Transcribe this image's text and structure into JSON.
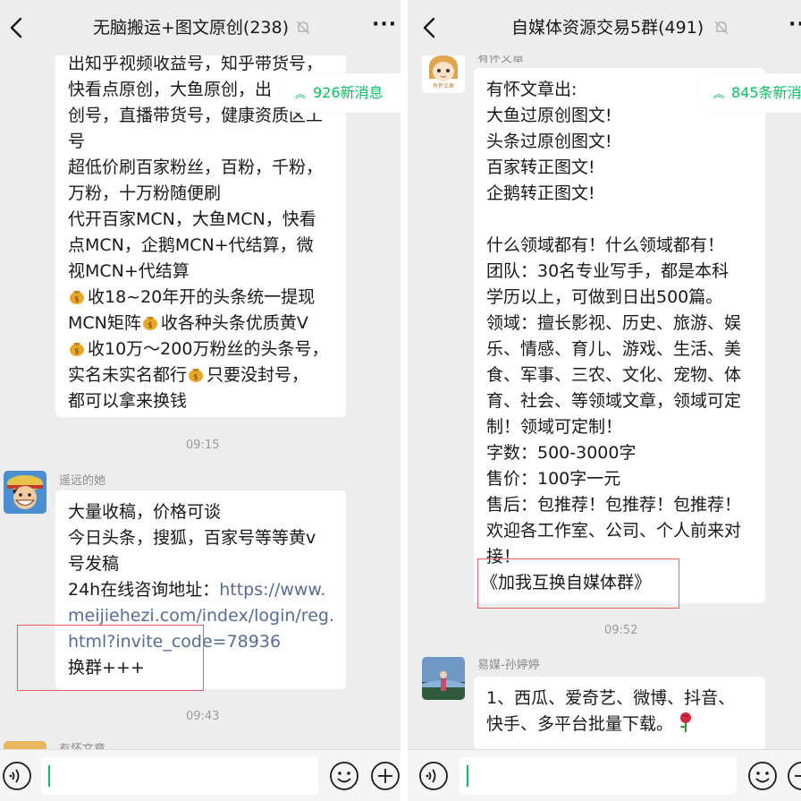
{
  "left_chat": {
    "title": "无脑搬运+图文原创(238)",
    "new_messages": "926新消息",
    "message_top": {
      "lines": [
        "出知乎视频收益号，知乎带货号，",
        "快看点原创，大鱼原创，出",
        "创号，直播带货号，健康资质区工",
        "号",
        "超低价刷百家粉丝，百粉，千粉，",
        "万粉，十万粉随便刷",
        "代开百家MCN，大鱼MCN，快看",
        "点MCN，企鹅MCN+代结算，微",
        "视MCN+代结算"
      ],
      "coin_lines": [
        [
          "收18~20年开的头条统一提现"
        ],
        [
          "MCN矩阵",
          "收各种头条优质黄V"
        ],
        [
          "收10万～200万粉丝的头条号，"
        ],
        [
          "实名未实名都行",
          "只要没封号，"
        ]
      ],
      "tail": "都可以拿来换钱"
    },
    "time1": "09:15",
    "sender2": "遥远的她",
    "message2": {
      "line1": "大量收稿，价格可谈",
      "line2": "今日头条，搜狐，百家号等等黄v",
      "line3": "号发稿",
      "line4_prefix": "24h在线咨询地址：",
      "line4_link": "https://www.",
      "line5_link": "meijiehezi.com/index/login/reg.",
      "line6_link": "html?invite_code=78936",
      "line7": "换群+++"
    },
    "time2": "09:43",
    "sender3_partial": "有怀文章"
  },
  "right_chat": {
    "title": "自媒体资源交易5群(491)",
    "new_messages": "845条新消",
    "sender1": "有怀文章",
    "avatar1_caption": "有怀文章",
    "message1": [
      "有怀文章出:",
      "大鱼过原创图文!",
      "头条过原创图文!",
      "百家转正图文!",
      "企鹅转正图文!",
      "",
      "什么领域都有！什么领域都有！",
      "团队：30名专业写手，都是本科",
      "学历以上，可做到日出500篇。",
      "领域：擅长影视、历史、旅游、娱",
      "乐、情感、育儿、游戏、生活、美",
      "食、军事、三农、文化、宠物、体",
      "育、社会、等领域文章，领域可定",
      "制！领域可定制！",
      "字数：500-3000字",
      "售价：100字一元",
      "售后：包推荐！包推荐！包推荐！",
      "欢迎各工作室、公司、个人前来对",
      "接！",
      "《加我互换自媒体群》"
    ],
    "time1": "09:52",
    "sender2": "易媒-孙婷婷",
    "message2": [
      "1、西瓜、爱奇艺、微博、抖音、",
      "快手、多平台批量下载。"
    ]
  },
  "colors": {
    "background": "#ededed",
    "bubble": "#ffffff",
    "link": "#576b95",
    "accent": "#07c160",
    "highlight_box": "#e86060"
  },
  "icons": [
    "back-icon",
    "mute-icon",
    "more-icon",
    "voice-icon",
    "emoji-icon",
    "plus-icon",
    "coin-bag-icon",
    "rose-icon"
  ]
}
